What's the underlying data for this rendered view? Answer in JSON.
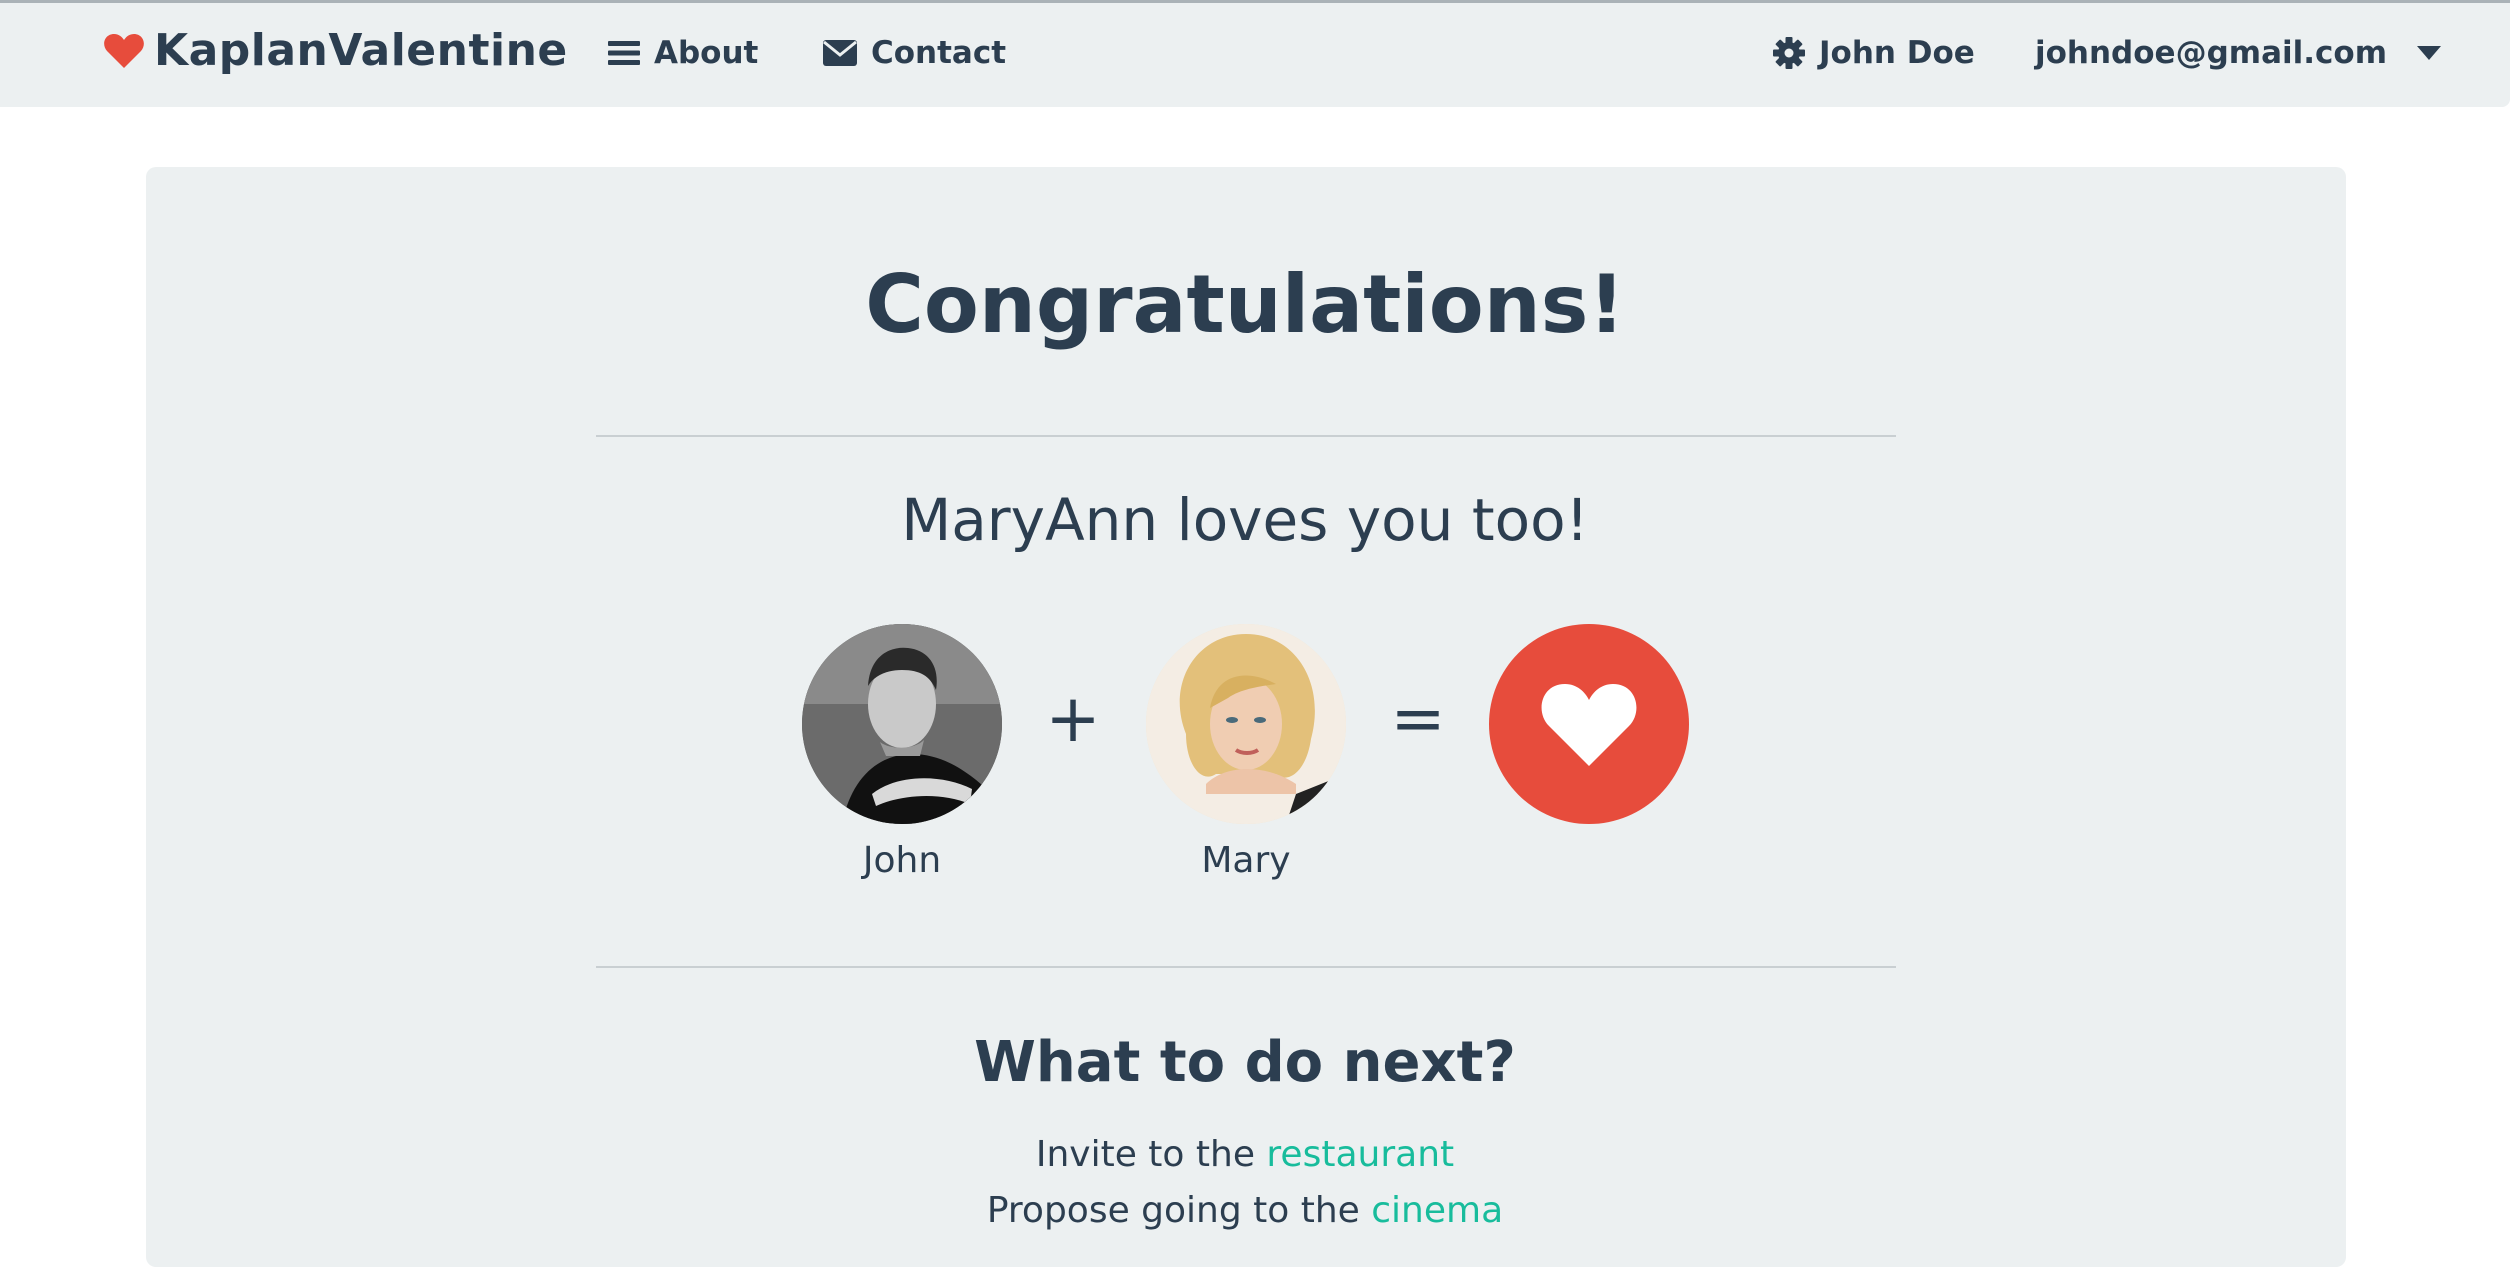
{
  "navbar": {
    "brand": "KaplanValentine",
    "about_label": "About",
    "contact_label": "Contact",
    "user_label": "John Doe",
    "email_label": "johndoe@gmail.com"
  },
  "main": {
    "title": "Congratulations!",
    "subtitle": "MaryAnn loves you too!",
    "person1_name": "John",
    "person2_name": "Mary",
    "plus": "+",
    "equals": "=",
    "next_title": "What to do next?",
    "suggestions": [
      {
        "prefix": "Invite to the ",
        "link": "restaurant"
      },
      {
        "prefix": "Propose going to the ",
        "link": "cinema"
      }
    ]
  },
  "colors": {
    "primary": "#2c3e50",
    "background": "#ecf0f1",
    "accent": "#e74c3c",
    "link": "#18bc9c"
  },
  "icons": {
    "brand": "heart-icon",
    "about": "bars-icon",
    "contact": "envelope-icon",
    "user": "gear-icon",
    "dropdown": "caret-down-icon",
    "match": "heart-icon"
  }
}
